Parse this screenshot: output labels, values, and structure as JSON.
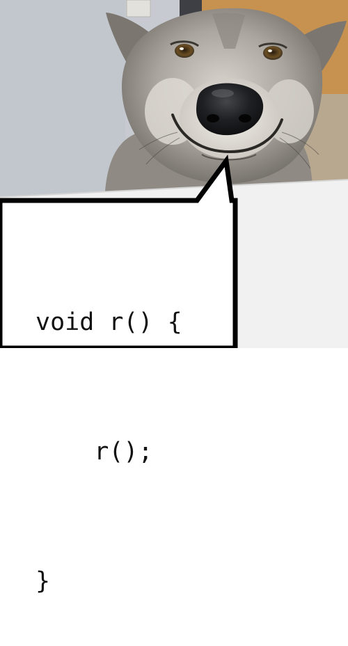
{
  "meme": {
    "code_lines": [
      "void r() {",
      "    r();",
      "}"
    ]
  },
  "colors": {
    "wall": "#c7cbd1",
    "door": "#c79250",
    "desk": "#f1f1f1",
    "fur_light": "#b7b3ad",
    "fur_dark": "#6a665f",
    "nose": "#1a1b1e",
    "bubble_fill": "#ffffff",
    "bubble_stroke": "#000000"
  },
  "icons": {
    "subject": "wolf-icon",
    "bubble": "speech-bubble-icon"
  }
}
